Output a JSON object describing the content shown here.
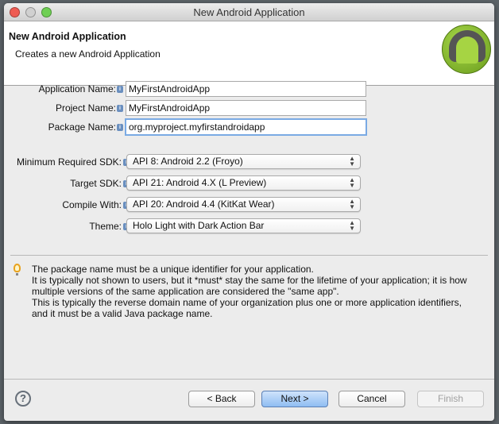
{
  "window": {
    "title": "New Android Application"
  },
  "header": {
    "title": "New Android Application",
    "subtitle": "Creates a new Android Application",
    "logo": "android-logo"
  },
  "form": {
    "fields": [
      {
        "label": "Application Name:",
        "value": "MyFirstAndroidApp"
      },
      {
        "label": "Project Name:",
        "value": "MyFirstAndroidApp"
      },
      {
        "label": "Package Name:",
        "value": "org.myproject.myfirstandroidapp"
      }
    ],
    "selects": [
      {
        "label": "Minimum Required SDK:",
        "value": "API 8: Android 2.2 (Froyo)"
      },
      {
        "label": "Target SDK:",
        "value": "API 21: Android 4.X (L Preview)"
      },
      {
        "label": "Compile With:",
        "value": "API 20: Android 4.4 (KitKat Wear)"
      },
      {
        "label": "Theme:",
        "value": "Holo Light with Dark Action Bar"
      }
    ]
  },
  "hint": {
    "lines": [
      "The package name must be a unique identifier for your application.",
      "It is typically not shown to users, but it *must* stay the same for the lifetime of your application; it is how",
      "multiple versions of the same application are considered the \"same app\".",
      "This is typically the reverse domain name of your organization plus one or more application identifiers,",
      "and it must be a valid Java package name."
    ]
  },
  "buttons": {
    "help": "?",
    "back": "< Back",
    "next": "Next >",
    "cancel": "Cancel",
    "finish": "Finish"
  }
}
